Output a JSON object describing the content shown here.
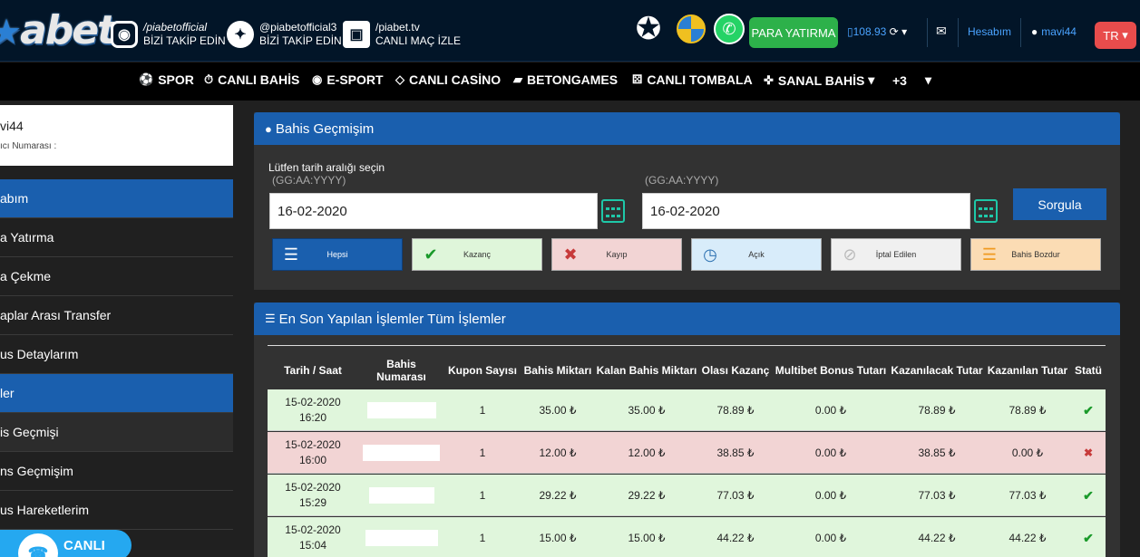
{
  "header": {
    "logo": "abet",
    "social": [
      {
        "handle": "/piabetofficial",
        "caption": "BİZİ TAKİP EDİN",
        "icon": "instagram-icon"
      },
      {
        "handle": "@piabetofficial3",
        "caption": "BİZİ TAKİP EDİN",
        "icon": "twitter-icon"
      },
      {
        "handle": "/piabet.tv",
        "caption": "CANLI MAÇ İZLE",
        "icon": "tv-icon"
      }
    ],
    "deposit_label": "PARA YATIRMA",
    "balance": "108.93",
    "account_label": "Hesabım",
    "username": "mavi44",
    "lang": "TR"
  },
  "nav": [
    {
      "label": "SPOR",
      "icon": "soccer-ball-icon"
    },
    {
      "label": "CANLI BAHİS",
      "icon": "stopwatch-icon"
    },
    {
      "label": "E-SPORT",
      "icon": "esport-icon"
    },
    {
      "label": "CANLI CASİNO",
      "icon": "diamond-icon"
    },
    {
      "label": "BETONGAMES",
      "icon": "ticket-icon"
    },
    {
      "label": "CANLI TOMBALA",
      "icon": "dice-icon"
    },
    {
      "label": "SANAL BAHİS",
      "icon": "gamepad-icon"
    },
    {
      "label": "+3",
      "icon": "chevron-down-icon"
    }
  ],
  "sidebar": {
    "username": "vi44",
    "user_number_label": "ıcı Numarası :",
    "items": [
      {
        "label": "abım"
      },
      {
        "label": "a Yatırma"
      },
      {
        "label": "a Çekme"
      },
      {
        "label": "aplar Arası Transfer"
      },
      {
        "label": "us Detaylarım"
      },
      {
        "label": "ler"
      },
      {
        "label": "is Geçmişi"
      },
      {
        "label": "ns Geçmişim"
      },
      {
        "label": "us Hareketlerim"
      }
    ],
    "live_label": "CANLI"
  },
  "history": {
    "title": "Bahis Geçmişim",
    "range_label": "Lütfen tarih aralığı seçin",
    "format_hint": "(GG:AA:YYYY)",
    "start_date": "16-02-2020",
    "end_date": "16-02-2020",
    "query_label": "Sorgula",
    "filters": [
      "Hepsi",
      "Kazanç",
      "Kayıp",
      "Açık",
      "İptal Edilen",
      "Bahis Bozdur"
    ]
  },
  "transactions": {
    "title": "En Son Yapılan İşlemler Tüm İşlemler",
    "columns": [
      "Tarih / Saat",
      "Bahis Numarası",
      "Kupon Sayısı",
      "Bahis Miktarı",
      "Kalan Bahis Miktarı",
      "Olası Kazanç",
      "Multibet Bonus Tutarı",
      "Kazanılacak Tutar",
      "Kazanılan Tutar",
      "Statü"
    ],
    "rows": [
      {
        "date": "15-02-2020",
        "time": "16:20",
        "count": "1",
        "amount": "35.00 ₺",
        "remaining": "35.00 ₺",
        "possible": "78.89 ₺",
        "bonus": "0.00 ₺",
        "to_win": "78.89 ₺",
        "won": "78.89 ₺",
        "status": "won"
      },
      {
        "date": "15-02-2020",
        "time": "16:00",
        "count": "1",
        "amount": "12.00 ₺",
        "remaining": "12.00 ₺",
        "possible": "38.85 ₺",
        "bonus": "0.00 ₺",
        "to_win": "38.85 ₺",
        "won": "0.00 ₺",
        "status": "lost"
      },
      {
        "date": "15-02-2020",
        "time": "15:29",
        "count": "1",
        "amount": "29.22 ₺",
        "remaining": "29.22 ₺",
        "possible": "77.03 ₺",
        "bonus": "0.00 ₺",
        "to_win": "77.03 ₺",
        "won": "77.03 ₺",
        "status": "won"
      },
      {
        "date": "15-02-2020",
        "time": "15:04",
        "count": "1",
        "amount": "15.00 ₺",
        "remaining": "15.00 ₺",
        "possible": "44.22 ₺",
        "bonus": "0.00 ₺",
        "to_win": "44.22 ₺",
        "won": "44.22 ₺",
        "status": "won"
      }
    ]
  }
}
